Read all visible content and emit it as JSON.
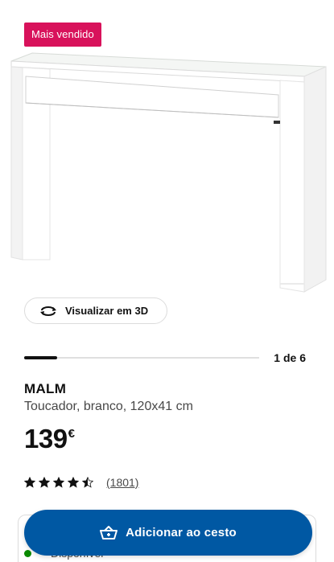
{
  "badge": {
    "label": "Mais vendido"
  },
  "view3d": {
    "label": "Visualizar em 3D",
    "icon": "rotate-3d-icon"
  },
  "gallery": {
    "current": 1,
    "total": 6,
    "counter": "1 de 6"
  },
  "product": {
    "name": "MALM",
    "description": "Toucador, branco, 120x41 cm",
    "price_integer": "139",
    "price_currency": "€",
    "rating": 4.5,
    "rating_max": 5,
    "reviews": "(1801)"
  },
  "availability": {
    "label": "Disponível",
    "color": "#0a8a00"
  },
  "cart_button": {
    "label": "Adicionar ao cesto",
    "icon": "basket-icon"
  },
  "colors": {
    "badge": "#d8125b",
    "primary": "#0058a3"
  }
}
